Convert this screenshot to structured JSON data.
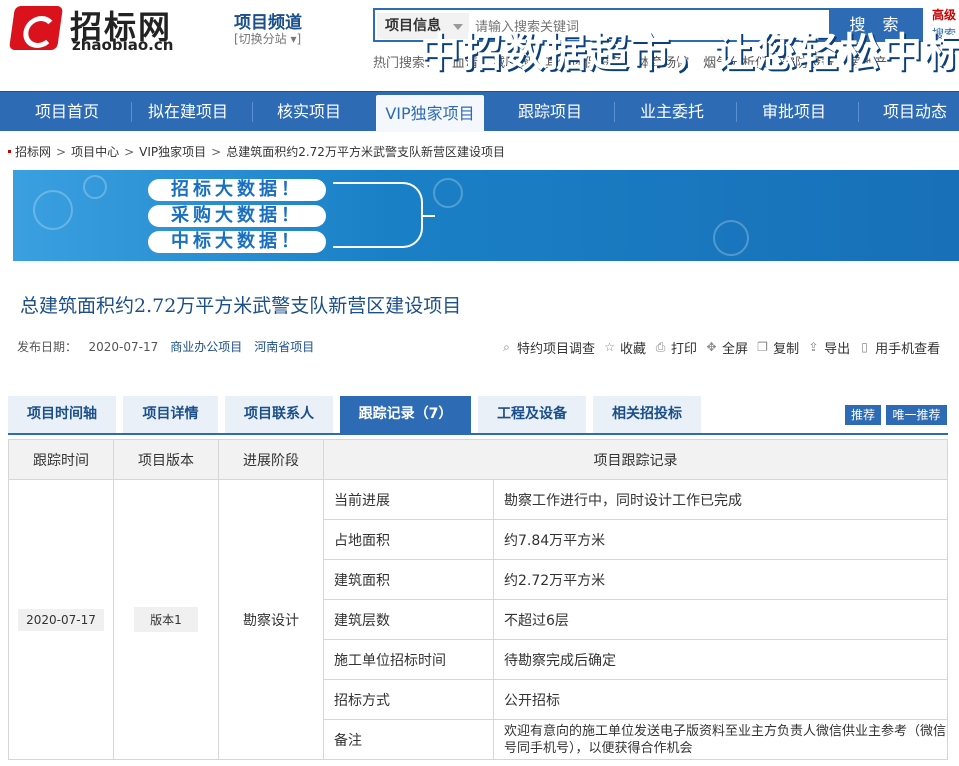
{
  "header": {
    "logo_cn": "招标网",
    "logo_en": "zhaobiao.cn",
    "channel_title": "项目频道",
    "channel_switch": "[切换分站 ▾]",
    "search_select": "项目信息",
    "search_placeholder": "请输入搜索关键词",
    "search_button": "搜 索",
    "advanced": "高级",
    "advanced2": "搜索",
    "hot_label": "热门搜索：",
    "hot_keywords": [
      "血清",
      "减压阀",
      "其他环保设备",
      "体育场馆",
      "烟气分析仪",
      "安防设备",
      "房地产"
    ]
  },
  "nav": {
    "items": [
      "项目首页",
      "拟在建项目",
      "核实项目",
      "VIP独家项目",
      "跟踪项目",
      "业主委托",
      "审批项目",
      "项目动态"
    ]
  },
  "breadcrumb": [
    "招标网",
    "项目中心",
    "VIP独家项目",
    "总建筑面积约2.72万平方米武警支队新营区建设项目"
  ],
  "banner": {
    "pills": [
      "招标大数据！",
      "采购大数据！",
      "中标大数据！"
    ],
    "slogan": "中招数据超市，让您轻松中标"
  },
  "project": {
    "title": "总建筑面积约2.72万平方米武警支队新营区建设项目",
    "date_label": "发布日期：",
    "date": "2020-07-17",
    "tag1": "商业办公项目",
    "tag2": "河南省项目"
  },
  "tools": [
    "特约项目调查",
    "收藏",
    "打印",
    "全屏",
    "复制",
    "导出",
    "用手机查看"
  ],
  "tabs": [
    "项目时间轴",
    "项目详情",
    "项目联系人",
    "跟踪记录（7）",
    "工程及设备",
    "相关招投标"
  ],
  "right_buttons": [
    "推荐",
    "唯一推荐"
  ],
  "table": {
    "headers": [
      "跟踪时间",
      "项目版本",
      "进展阶段",
      "项目跟踪记录"
    ],
    "time": "2020-07-17",
    "version": "版本1",
    "stage": "勘察设计",
    "rows": [
      {
        "k": "当前进展",
        "v": "勘察工作进行中，同时设计工作已完成"
      },
      {
        "k": "占地面积",
        "v": "约7.84万平方米"
      },
      {
        "k": "建筑面积",
        "v": "约2.72万平方米"
      },
      {
        "k": "建筑层数",
        "v": "不超过6层"
      },
      {
        "k": "施工单位招标时间",
        "v": "待勘察完成后确定"
      },
      {
        "k": "招标方式",
        "v": "公开招标"
      },
      {
        "k": "备注",
        "v": "欢迎有意向的施工单位发送电子版资料至业主方负责人微信供业主参考（微信号同手机号），以便获得合作机会"
      }
    ]
  }
}
